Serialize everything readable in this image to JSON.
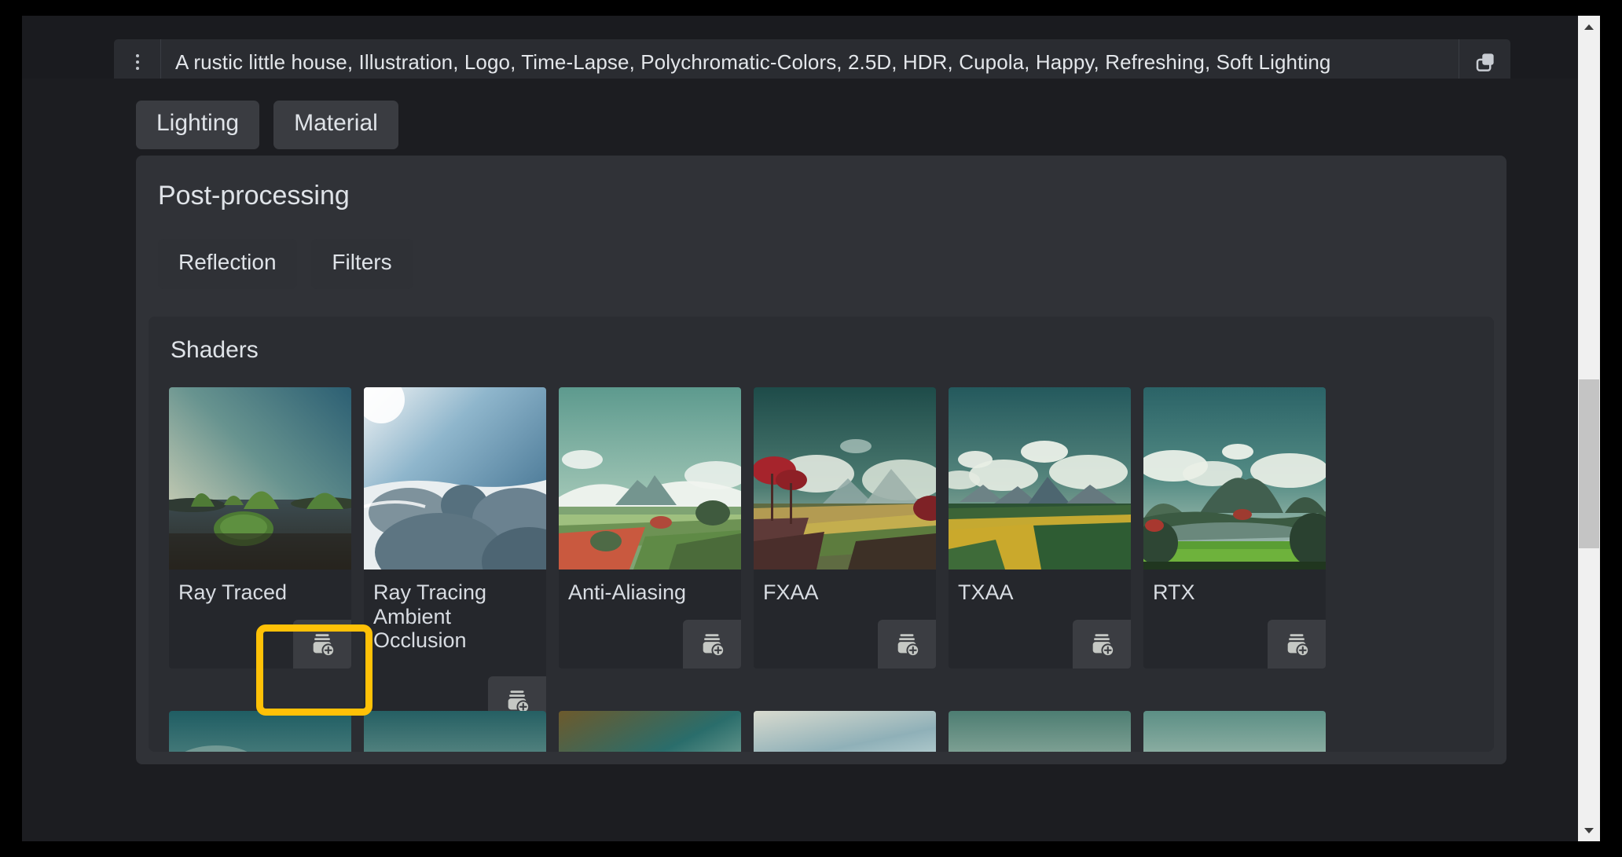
{
  "prompt_bar": {
    "menu_icon": "kebab-menu-icon",
    "text": "A rustic little house, Illustration, Logo, Time-Lapse, Polychromatic-Colors, 2.5D, HDR, Cupola, Happy, Refreshing, Soft Lighting",
    "copy_icon": "copy-icon"
  },
  "tabs": [
    {
      "label": "Lighting"
    },
    {
      "label": "Material"
    }
  ],
  "post_processing": {
    "title": "Post-processing",
    "buttons": [
      {
        "label": "Reflection"
      },
      {
        "label": "Filters"
      }
    ]
  },
  "shaders": {
    "title": "Shaders",
    "add_icon": "add-to-stack-icon",
    "cards": [
      {
        "label": "Ray Traced",
        "thumb": "green-islands-on-water"
      },
      {
        "label": "Ray Tracing Ambient Occlusion",
        "thumb": "white-snow-domes"
      },
      {
        "label": "Anti-Aliasing",
        "thumb": "teal-sky-mountain-fields"
      },
      {
        "label": "FXAA",
        "thumb": "dark-teal-red-trees-fields"
      },
      {
        "label": "TXAA",
        "thumb": "teal-clouds-yellow-green-fields"
      },
      {
        "label": "RTX",
        "thumb": "teal-sky-volcano-green-valley"
      }
    ],
    "cards_row2": [
      {
        "thumb": "teal-clouds-red-bush"
      },
      {
        "thumb": "teal-clouds-red-tree"
      },
      {
        "thumb": "orange-teal-clouds"
      },
      {
        "thumb": "pale-blue-clouds"
      },
      {
        "thumb": "muted-teal-clouds"
      },
      {
        "thumb": "soft-teal-clouds"
      }
    ]
  },
  "annotation": {
    "name": "highlight-box",
    "color": "#ffc107"
  },
  "scrollbar": {
    "up_arrow": "scroll-up-arrow",
    "down_arrow": "scroll-down-arrow"
  },
  "colors": {
    "page_bg": "#1c1d21",
    "panel_bg": "#303237",
    "subpanel_bg": "#2b2d32",
    "card_bg": "#25272c",
    "chip_bg": "#3a3c41",
    "text": "#dfe3e8",
    "accent": "#ffc107"
  }
}
